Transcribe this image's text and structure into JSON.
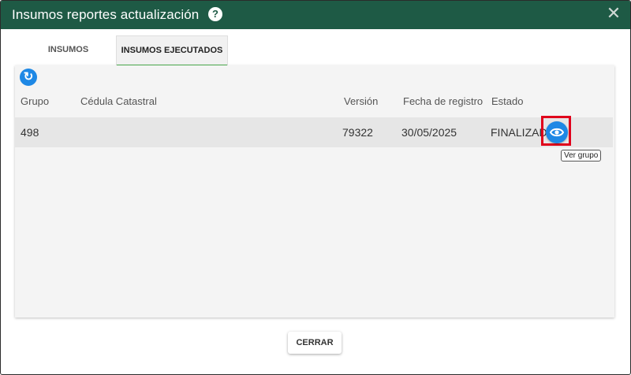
{
  "dialog": {
    "title": "Insumos reportes actualización",
    "help_icon": "question-circle-icon",
    "close_icon": "close-icon",
    "header_color": "#1e5a45"
  },
  "tabs": [
    {
      "label": "INSUMOS",
      "active": false
    },
    {
      "label": "INSUMOS EJECUTADOS",
      "active": true
    }
  ],
  "table": {
    "refresh_icon": "refresh-icon",
    "columns": [
      "Grupo",
      "Cédula Catastral",
      "Versión",
      "Fecha de registro",
      "Estado"
    ],
    "rows": [
      {
        "grupo": "498",
        "cedula": "",
        "version": "79322",
        "fecha": "30/05/2025",
        "estado": "FINALIZADO"
      }
    ]
  },
  "tooltip": "Ver grupo",
  "footer": {
    "close_label": "CERRAR"
  },
  "colors": {
    "accent": "#1e88e5",
    "tab_indicator": "#4caf50",
    "highlight": "#e0001b"
  }
}
